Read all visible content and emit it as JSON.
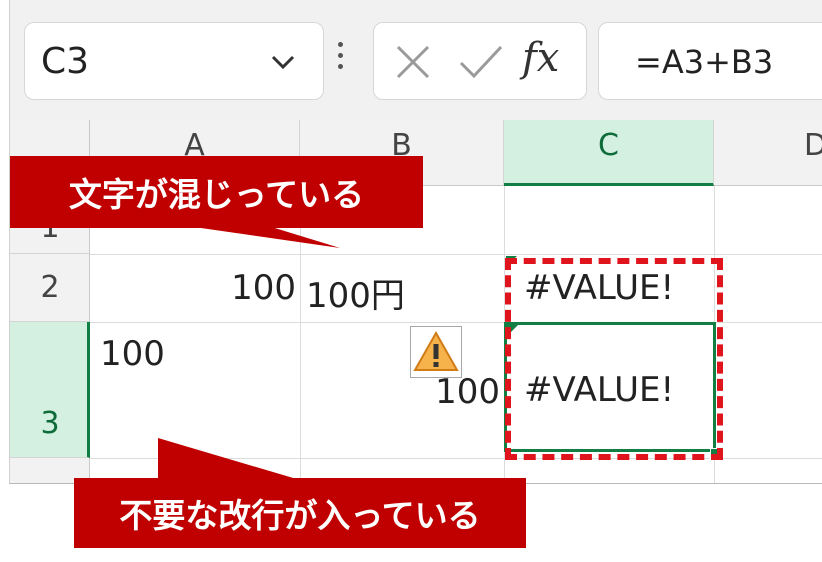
{
  "formula_bar": {
    "name_box": "C3",
    "formula": "=A3+B3",
    "fx_label": "fx",
    "cancel_icon": "close-icon",
    "enter_icon": "check-icon"
  },
  "columns": [
    "A",
    "B",
    "C",
    "D"
  ],
  "rows": [
    "1",
    "2",
    "3"
  ],
  "cells": {
    "A2": "100",
    "B2": "100円",
    "C2": "#VALUE!",
    "A3": "100",
    "B3": "100",
    "C3": "#VALUE!"
  },
  "selected": {
    "column": "C",
    "row": "3"
  },
  "callouts": {
    "mixed_text": "文字が混じっている",
    "extra_linebreak": "不要な改行が入っている"
  },
  "colors": {
    "callout": "#c00000",
    "highlight_dash": "#e0141c",
    "selection_green": "#137e43"
  }
}
